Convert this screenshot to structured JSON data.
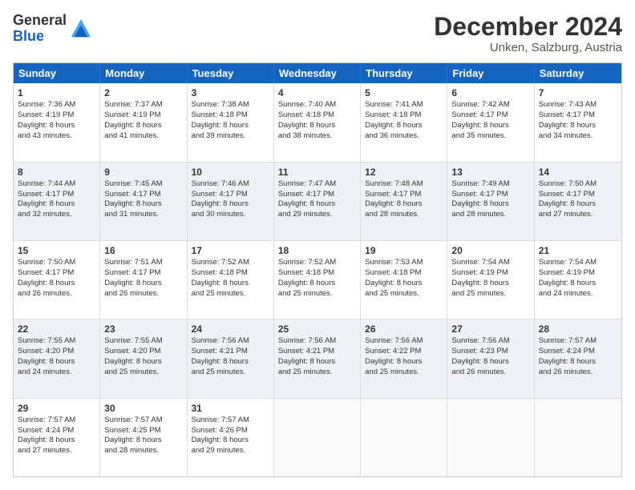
{
  "logo": {
    "line1": "General",
    "line2": "Blue"
  },
  "title": "December 2024",
  "location": "Unken, Salzburg, Austria",
  "days_of_week": [
    "Sunday",
    "Monday",
    "Tuesday",
    "Wednesday",
    "Thursday",
    "Friday",
    "Saturday"
  ],
  "weeks": [
    [
      {
        "day": "1",
        "info": "Sunrise: 7:36 AM\nSunset: 4:19 PM\nDaylight: 8 hours\nand 43 minutes."
      },
      {
        "day": "2",
        "info": "Sunrise: 7:37 AM\nSunset: 4:19 PM\nDaylight: 8 hours\nand 41 minutes."
      },
      {
        "day": "3",
        "info": "Sunrise: 7:38 AM\nSunset: 4:18 PM\nDaylight: 8 hours\nand 39 minutes."
      },
      {
        "day": "4",
        "info": "Sunrise: 7:40 AM\nSunset: 4:18 PM\nDaylight: 8 hours\nand 38 minutes."
      },
      {
        "day": "5",
        "info": "Sunrise: 7:41 AM\nSunset: 4:18 PM\nDaylight: 8 hours\nand 36 minutes."
      },
      {
        "day": "6",
        "info": "Sunrise: 7:42 AM\nSunset: 4:17 PM\nDaylight: 8 hours\nand 35 minutes."
      },
      {
        "day": "7",
        "info": "Sunrise: 7:43 AM\nSunset: 4:17 PM\nDaylight: 8 hours\nand 34 minutes."
      }
    ],
    [
      {
        "day": "8",
        "info": "Sunrise: 7:44 AM\nSunset: 4:17 PM\nDaylight: 8 hours\nand 32 minutes."
      },
      {
        "day": "9",
        "info": "Sunrise: 7:45 AM\nSunset: 4:17 PM\nDaylight: 8 hours\nand 31 minutes."
      },
      {
        "day": "10",
        "info": "Sunrise: 7:46 AM\nSunset: 4:17 PM\nDaylight: 8 hours\nand 30 minutes."
      },
      {
        "day": "11",
        "info": "Sunrise: 7:47 AM\nSunset: 4:17 PM\nDaylight: 8 hours\nand 29 minutes."
      },
      {
        "day": "12",
        "info": "Sunrise: 7:48 AM\nSunset: 4:17 PM\nDaylight: 8 hours\nand 28 minutes."
      },
      {
        "day": "13",
        "info": "Sunrise: 7:49 AM\nSunset: 4:17 PM\nDaylight: 8 hours\nand 28 minutes."
      },
      {
        "day": "14",
        "info": "Sunrise: 7:50 AM\nSunset: 4:17 PM\nDaylight: 8 hours\nand 27 minutes."
      }
    ],
    [
      {
        "day": "15",
        "info": "Sunrise: 7:50 AM\nSunset: 4:17 PM\nDaylight: 8 hours\nand 26 minutes."
      },
      {
        "day": "16",
        "info": "Sunrise: 7:51 AM\nSunset: 4:17 PM\nDaylight: 8 hours\nand 26 minutes."
      },
      {
        "day": "17",
        "info": "Sunrise: 7:52 AM\nSunset: 4:18 PM\nDaylight: 8 hours\nand 25 minutes."
      },
      {
        "day": "18",
        "info": "Sunrise: 7:52 AM\nSunset: 4:18 PM\nDaylight: 8 hours\nand 25 minutes."
      },
      {
        "day": "19",
        "info": "Sunrise: 7:53 AM\nSunset: 4:18 PM\nDaylight: 8 hours\nand 25 minutes."
      },
      {
        "day": "20",
        "info": "Sunrise: 7:54 AM\nSunset: 4:19 PM\nDaylight: 8 hours\nand 25 minutes."
      },
      {
        "day": "21",
        "info": "Sunrise: 7:54 AM\nSunset: 4:19 PM\nDaylight: 8 hours\nand 24 minutes."
      }
    ],
    [
      {
        "day": "22",
        "info": "Sunrise: 7:55 AM\nSunset: 4:20 PM\nDaylight: 8 hours\nand 24 minutes."
      },
      {
        "day": "23",
        "info": "Sunrise: 7:55 AM\nSunset: 4:20 PM\nDaylight: 8 hours\nand 25 minutes."
      },
      {
        "day": "24",
        "info": "Sunrise: 7:56 AM\nSunset: 4:21 PM\nDaylight: 8 hours\nand 25 minutes."
      },
      {
        "day": "25",
        "info": "Sunrise: 7:56 AM\nSunset: 4:21 PM\nDaylight: 8 hours\nand 25 minutes."
      },
      {
        "day": "26",
        "info": "Sunrise: 7:56 AM\nSunset: 4:22 PM\nDaylight: 8 hours\nand 25 minutes."
      },
      {
        "day": "27",
        "info": "Sunrise: 7:56 AM\nSunset: 4:23 PM\nDaylight: 8 hours\nand 26 minutes."
      },
      {
        "day": "28",
        "info": "Sunrise: 7:57 AM\nSunset: 4:24 PM\nDaylight: 8 hours\nand 26 minutes."
      }
    ],
    [
      {
        "day": "29",
        "info": "Sunrise: 7:57 AM\nSunset: 4:24 PM\nDaylight: 8 hours\nand 27 minutes."
      },
      {
        "day": "30",
        "info": "Sunrise: 7:57 AM\nSunset: 4:25 PM\nDaylight: 8 hours\nand 28 minutes."
      },
      {
        "day": "31",
        "info": "Sunrise: 7:57 AM\nSunset: 4:26 PM\nDaylight: 8 hours\nand 29 minutes."
      },
      {
        "day": "",
        "info": ""
      },
      {
        "day": "",
        "info": ""
      },
      {
        "day": "",
        "info": ""
      },
      {
        "day": "",
        "info": ""
      }
    ]
  ]
}
